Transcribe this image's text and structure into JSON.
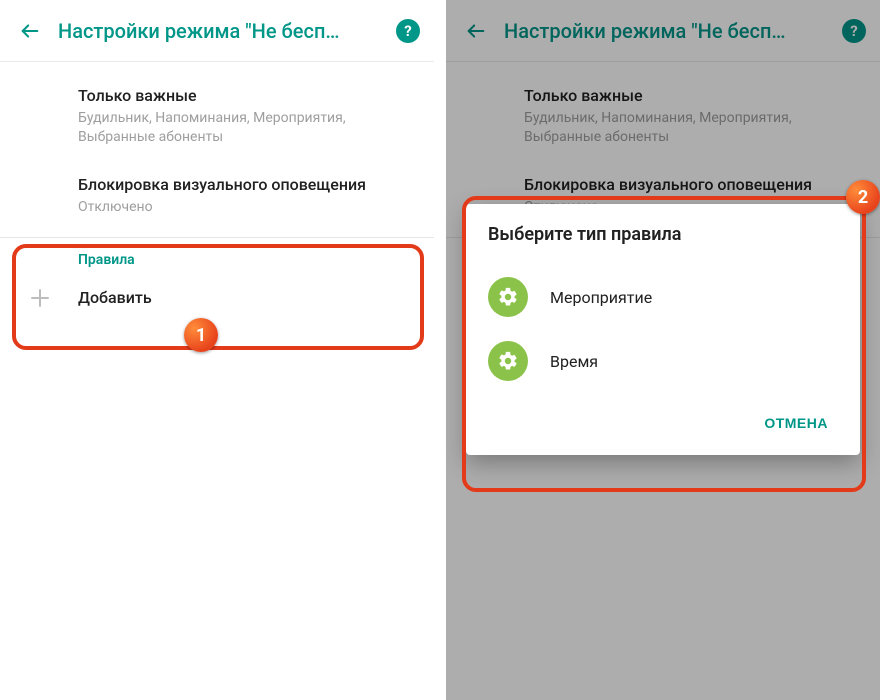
{
  "appbar": {
    "title": "Настройки режима \"Не бесп…",
    "help_glyph": "?"
  },
  "rows": {
    "priority": {
      "title": "Только важные",
      "subtitle": "Будильник, Напоминания, Мероприятия, Выбранные абоненты"
    },
    "visual": {
      "title": "Блокировка визуального оповещения",
      "subtitle": "Отключено"
    }
  },
  "rules": {
    "header": "Правила",
    "add": "Добавить"
  },
  "dialog": {
    "title": "Выберите тип правила",
    "event": "Мероприятие",
    "time": "Время",
    "cancel": "ОТМЕНА"
  },
  "badges": {
    "one": "1",
    "two": "2"
  }
}
